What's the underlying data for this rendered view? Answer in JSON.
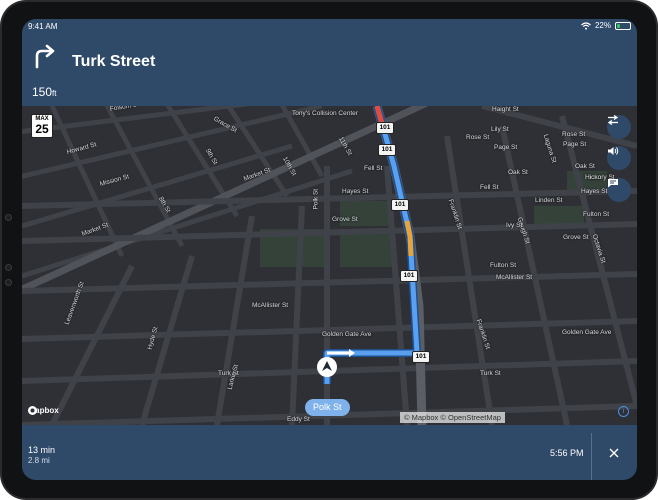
{
  "status": {
    "time": "9:41 AM",
    "battery": "22%",
    "battery_level": 0.22
  },
  "instruction": {
    "distance_value": "150",
    "distance_unit": "ft",
    "street": "Turk Street",
    "maneuver_icon": "turn-right-arrow-icon"
  },
  "speed_limit": {
    "label": "MAX",
    "value": "25"
  },
  "map": {
    "labels": [
      "Tony's Collision Center",
      "Howard St",
      "Mission St",
      "Market St",
      "Market St",
      "9th St",
      "10th St",
      "11th St",
      "8th St",
      "Grace St",
      "Folsom St",
      "Fell St",
      "Hayes St",
      "Grove St",
      "McAllister St",
      "McAllister St",
      "Golden Gate Ave",
      "Golden Gate Ave",
      "Turk St",
      "Turk St",
      "Eddy St",
      "Polk St",
      "Larkin St",
      "Hyde St",
      "Leavenworth St",
      "Franklin St",
      "Franklin St",
      "Gough St",
      "Octavia St",
      "Fulton St",
      "Fell St",
      "Ivy St",
      "Linden St",
      "Oak St",
      "Page St",
      "Rose St",
      "Lily St",
      "Grove St",
      "Fulton St",
      "Hayes St",
      "Haight St",
      "Hickory St",
      "Laguna St",
      "Rose St",
      "Page St",
      "Oak St",
      "Hicko"
    ],
    "route_shields": [
      "101",
      "101",
      "101",
      "101",
      "101"
    ],
    "wayname": "Polk St",
    "attribution": "© Mapbox © OpenStreetMap",
    "logo": "mapbox"
  },
  "controls": {
    "overview_icon": "route-overview-icon",
    "sound_icon": "speaker-icon",
    "feedback_icon": "feedback-icon"
  },
  "eta": {
    "duration": "13 min",
    "distance": "2.8 mi",
    "arrival": "5:56 PM"
  },
  "colors": {
    "panel": "#2f4969",
    "route": "#5aa0f0",
    "traffic_heavy": "#e8a43a",
    "traffic_severe": "#e24b3c",
    "map_bg": "#2e3035"
  }
}
